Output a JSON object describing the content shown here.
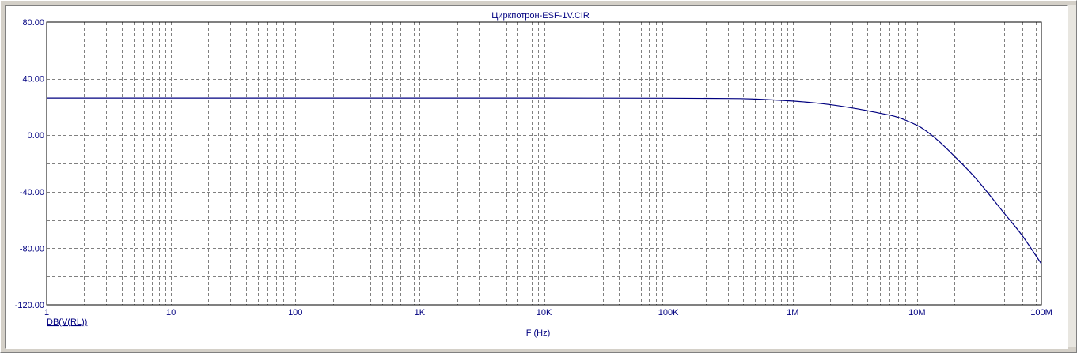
{
  "window": {
    "title": "Циркпотрон-ESF-1V.CIR"
  },
  "colors": {
    "axis_text": "#000080",
    "trace": "#000080",
    "grid": "#808080",
    "background": "#ffffff"
  },
  "chart_data": {
    "type": "line",
    "title": "Циркпотрон-ESF-1V.CIR",
    "xlabel": "F (Hz)",
    "ylabel": "DB(V(RL))",
    "x_scale": "log",
    "xlim": [
      1,
      100000000
    ],
    "ylim": [
      -120,
      80
    ],
    "grid": true,
    "x_ticks": [
      {
        "value": 1,
        "label": "1"
      },
      {
        "value": 10,
        "label": "10"
      },
      {
        "value": 100,
        "label": "100"
      },
      {
        "value": 1000,
        "label": "1K"
      },
      {
        "value": 10000,
        "label": "10K"
      },
      {
        "value": 100000,
        "label": "100K"
      },
      {
        "value": 1000000,
        "label": "1M"
      },
      {
        "value": 10000000,
        "label": "10M"
      },
      {
        "value": 100000000,
        "label": "100M"
      }
    ],
    "y_ticks": [
      {
        "value": 80,
        "label": "80.00"
      },
      {
        "value": 40,
        "label": "40.00"
      },
      {
        "value": 0,
        "label": "0.00"
      },
      {
        "value": -40,
        "label": "-40.00"
      },
      {
        "value": -80,
        "label": "-80.00"
      },
      {
        "value": -120,
        "label": "-120.00"
      }
    ],
    "series": [
      {
        "name": "DB(V(RL))",
        "color": "#000080",
        "x": [
          1,
          10,
          100,
          1000,
          10000,
          100000,
          300000,
          500000,
          700000,
          1000000,
          1500000,
          2000000,
          3000000,
          5000000,
          7000000,
          10000000,
          12000000,
          15000000,
          20000000,
          30000000,
          50000000,
          70000000,
          100000000
        ],
        "y": [
          26.3,
          26.3,
          26.3,
          26.3,
          26.3,
          26.2,
          26.0,
          25.6,
          25.0,
          24.2,
          22.9,
          21.6,
          19.3,
          15.6,
          12.7,
          7.0,
          2.6,
          -4.3,
          -14.9,
          -31.0,
          -55.0,
          -70.9,
          -91.0
        ]
      }
    ]
  }
}
